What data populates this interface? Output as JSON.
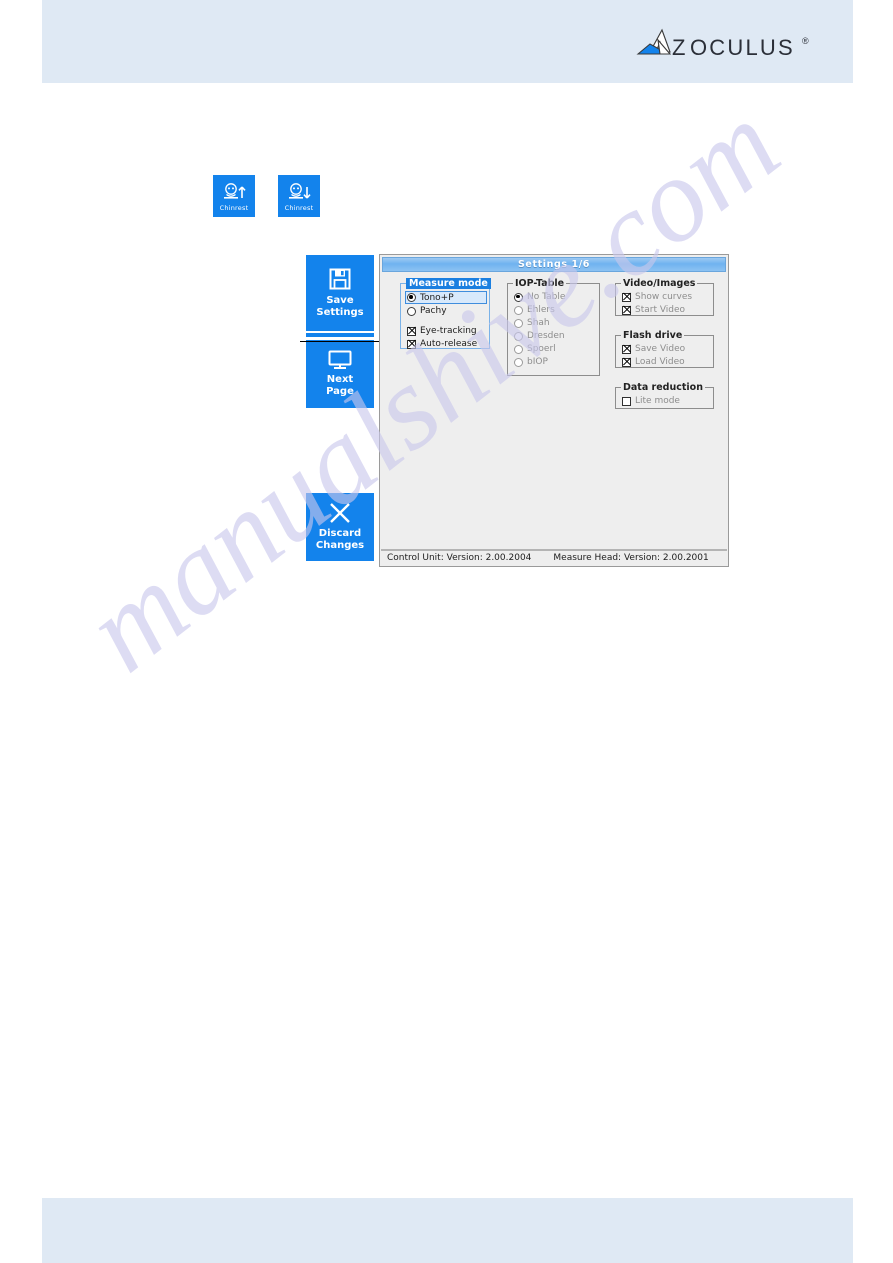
{
  "header": {
    "logo_text": "Z OCULUS",
    "logo_mark": "oculus-logo-icon",
    "registered_mark": "®"
  },
  "chinrest_buttons": [
    {
      "label": "Chinrest",
      "icon": "chinrest-up-icon",
      "direction": "up"
    },
    {
      "label": "Chinrest",
      "icon": "chinrest-down-icon",
      "direction": "down"
    }
  ],
  "side_buttons": [
    {
      "id": "save-settings",
      "line1": "Save",
      "line2": "Settings",
      "icon": "floppy-disk-icon"
    },
    {
      "id": "next-page",
      "line1": "Next",
      "line2": "Page",
      "icon": "monitor-icon"
    },
    {
      "id": "discard-changes",
      "line1": "Discard",
      "line2": "Changes",
      "icon": "close-x-icon"
    }
  ],
  "dialog": {
    "title": "Settings 1/6",
    "groups": {
      "measure_mode": {
        "legend": "Measure mode",
        "selected": true,
        "radios": [
          {
            "label": "Tono+P",
            "checked": true,
            "highlighted": true
          },
          {
            "label": "Pachy",
            "checked": false,
            "highlighted": false
          }
        ],
        "checkboxes": [
          {
            "label": "Eye-tracking",
            "checked": true
          },
          {
            "label": "Auto-release",
            "checked": true
          }
        ]
      },
      "iop_table": {
        "legend": "IOP-Table",
        "disabled": true,
        "radios": [
          {
            "label": "No Table",
            "checked": true
          },
          {
            "label": "Ehlers",
            "checked": false
          },
          {
            "label": "Shah",
            "checked": false
          },
          {
            "label": "Dresden",
            "checked": false
          },
          {
            "label": "Spoerl",
            "checked": false
          },
          {
            "label": "bIOP",
            "checked": false
          }
        ]
      },
      "video_images": {
        "legend": "Video/Images",
        "checkboxes": [
          {
            "label": "Show curves",
            "checked": true
          },
          {
            "label": "Start Video",
            "checked": true
          }
        ]
      },
      "flash_drive": {
        "legend": "Flash drive",
        "checkboxes": [
          {
            "label": "Save Video",
            "checked": true
          },
          {
            "label": "Load Video",
            "checked": true
          }
        ]
      },
      "data_reduction": {
        "legend": "Data reduction",
        "checkboxes": [
          {
            "label": "Lite mode",
            "checked": false
          }
        ]
      }
    },
    "status_bar": {
      "control_unit": "Control Unit: Version:  2.00.2004",
      "measure_head": "Measure Head: Version:  2.00.2001"
    }
  },
  "watermark": {
    "text": "manualshive.com"
  },
  "colors": {
    "band": "#dfe9f4",
    "button_blue": "#1383ec",
    "title_blue": "#6fb3f0",
    "dialog_bg": "#eeeeee",
    "highlight_row": "#d8e9fb",
    "legend_highlight": "#1b7fe0",
    "watermark": "#c9c8ec"
  }
}
